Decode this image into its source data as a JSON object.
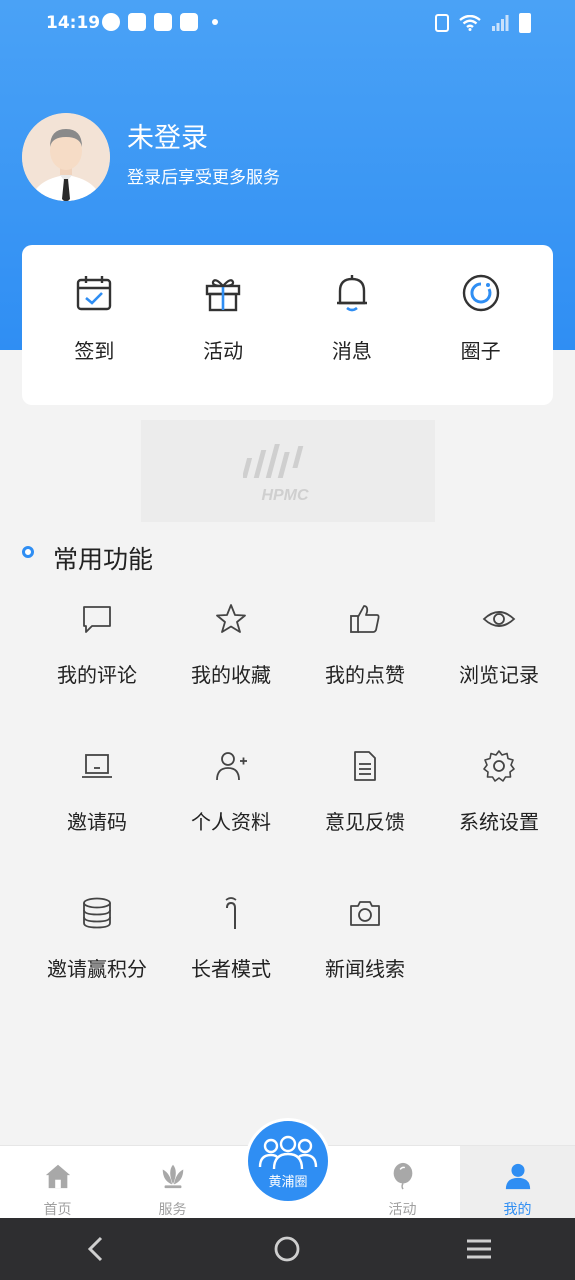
{
  "status_bar": {
    "time": "14:19"
  },
  "profile": {
    "name": "未登录",
    "subtitle": "登录后享受更多服务"
  },
  "quick_actions": [
    {
      "label": "签到",
      "icon": "calendar-check-icon"
    },
    {
      "label": "活动",
      "icon": "gift-icon"
    },
    {
      "label": "消息",
      "icon": "bell-icon"
    },
    {
      "label": "圈子",
      "icon": "circle-refresh-icon"
    }
  ],
  "banner": {
    "logo_text": "HPMC"
  },
  "section": {
    "title": "常用功能"
  },
  "functions": [
    {
      "label": "我的评论",
      "icon": "comment-icon"
    },
    {
      "label": "我的收藏",
      "icon": "star-icon"
    },
    {
      "label": "我的点赞",
      "icon": "thumbs-up-icon"
    },
    {
      "label": "浏览记录",
      "icon": "eye-icon"
    },
    {
      "label": "邀请码",
      "icon": "laptop-icon"
    },
    {
      "label": "个人资料",
      "icon": "add-user-icon"
    },
    {
      "label": "意见反馈",
      "icon": "document-icon"
    },
    {
      "label": "系统设置",
      "icon": "gear-icon"
    },
    {
      "label": "邀请赢积分",
      "icon": "database-icon"
    },
    {
      "label": "长者模式",
      "icon": "cane-icon"
    },
    {
      "label": "新闻线索",
      "icon": "camera-icon"
    }
  ],
  "tabs": [
    {
      "label": "首页",
      "icon": "home-icon"
    },
    {
      "label": "服务",
      "icon": "lotus-icon"
    },
    {
      "label": "黄浦圈",
      "icon": "group-icon"
    },
    {
      "label": "活动",
      "icon": "balloon-icon"
    },
    {
      "label": "我的",
      "icon": "person-icon"
    }
  ],
  "colors": {
    "accent": "#2f8ef3",
    "hero_top": "#4aa2f6",
    "background": "#f3f3f3"
  }
}
